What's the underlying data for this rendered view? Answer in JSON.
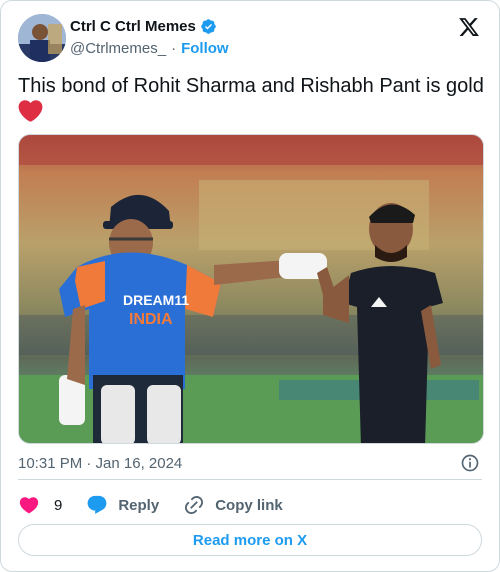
{
  "author": {
    "display_name": "Ctrl C Ctrl Memes",
    "handle": "@Ctrlmemes_",
    "separator": "·",
    "follow_label": "Follow",
    "verified": true
  },
  "tweet": {
    "text": "This bond of Rohit Sharma and Rishabh Pant is gold",
    "emoji": "heart-emoji",
    "media_caption": "Two cricketers greeting each other on a practice field",
    "jersey_text_line1": "DREAM11",
    "jersey_text_line2": "INDIA"
  },
  "meta": {
    "timestamp": "10:31 PM · Jan 16, 2024"
  },
  "actions": {
    "like_count": "9",
    "reply_label": "Reply",
    "copy_link_label": "Copy link"
  },
  "footer": {
    "read_more_label": "Read more on X"
  },
  "colors": {
    "accent": "#1d9bf0",
    "like": "#f91880",
    "text": "#0f1419",
    "muted": "#536471",
    "border": "#cfd9de"
  }
}
